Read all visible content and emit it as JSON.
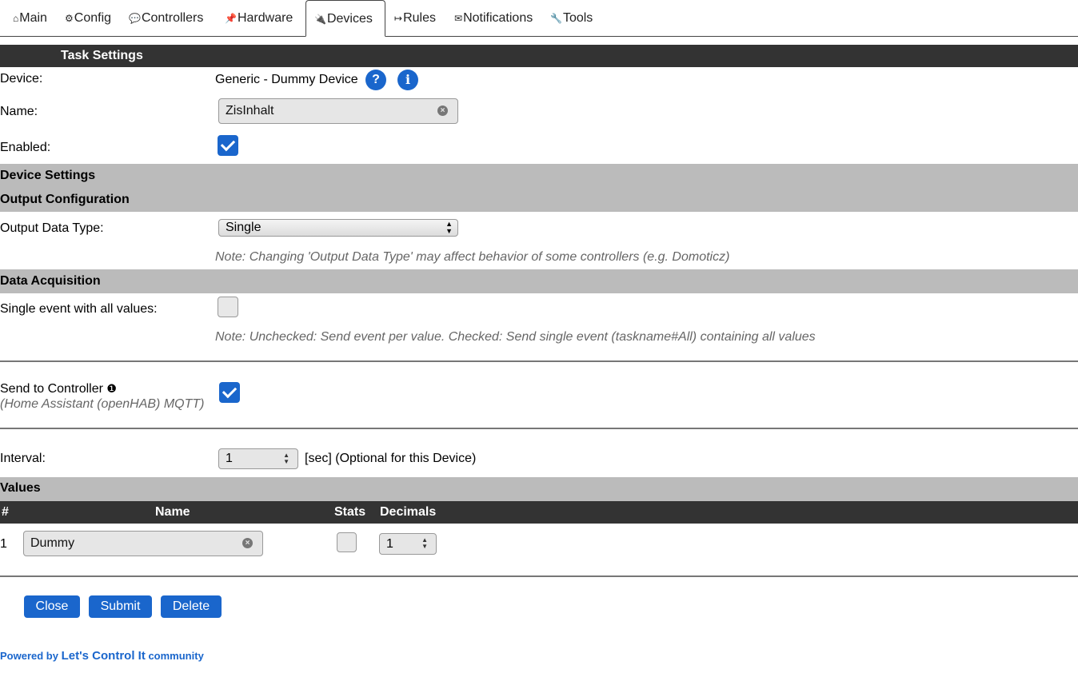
{
  "tabs": [
    {
      "icon": "⌂",
      "label": "Main"
    },
    {
      "icon": "⚙",
      "label": "Config"
    },
    {
      "icon": "💬",
      "label": "Controllers"
    },
    {
      "icon": "📌",
      "label": "Hardware"
    },
    {
      "icon": "🔌",
      "label": "Devices"
    },
    {
      "icon": "↦",
      "label": "Rules"
    },
    {
      "icon": "✉",
      "label": "Notifications"
    },
    {
      "icon": "🔧",
      "label": "Tools"
    }
  ],
  "active_tab": "Devices",
  "task_settings": {
    "header": "Task Settings",
    "device_label": "Device:",
    "device_value": "Generic - Dummy Device",
    "help_glyph": "?",
    "info_glyph": "i",
    "name_label": "Name:",
    "name_value": "ZisInhalt",
    "enabled_label": "Enabled:",
    "enabled": true
  },
  "device_settings": {
    "header": "Device Settings"
  },
  "output_config": {
    "header": "Output Configuration",
    "type_label": "Output Data Type:",
    "type_value": "Single",
    "note": "Note: Changing 'Output Data Type' may affect behavior of some controllers (e.g. Domoticz)"
  },
  "data_acquisition": {
    "header": "Data Acquisition",
    "single_event_label": "Single event with all values:",
    "single_event": false,
    "note": "Note: Unchecked: Send event per value. Checked: Send single event (taskname#All) containing all values",
    "send_label": "Send to Controller",
    "send_info_glyph": "❶",
    "send_sub": "(Home Assistant (openHAB) MQTT)",
    "send_enabled": true,
    "interval_label": "Interval:",
    "interval_value": "1",
    "interval_suffix": "[sec] (Optional for this Device)"
  },
  "values": {
    "header": "Values",
    "columns": [
      "#",
      "Name",
      "Stats",
      "Decimals"
    ],
    "rows": [
      {
        "index": "1",
        "name": "Dummy",
        "stats": false,
        "decimals": "1"
      }
    ]
  },
  "buttons": {
    "close": "Close",
    "submit": "Submit",
    "delete": "Delete"
  },
  "footer": {
    "prefix": "Powered by",
    "brand": "Let's Control It",
    "suffix": "community"
  },
  "colors": {
    "accent": "#1a66cc",
    "dark_bar": "#333333",
    "gray_bar": "#bbbbbb"
  }
}
